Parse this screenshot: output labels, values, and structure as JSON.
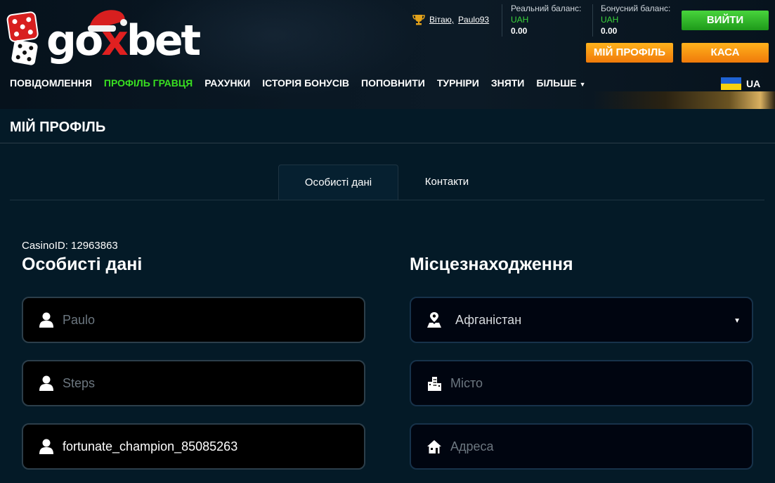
{
  "brand": {
    "logo_text_pre": "go",
    "logo_text_x": "x",
    "logo_text_post": "bet",
    "accent": "#39e020"
  },
  "user": {
    "greeting": "Вітаю,",
    "username": "Paulo93"
  },
  "balances": {
    "real": {
      "label": "Реальний баланс:",
      "currency": "UAH",
      "value": "0.00"
    },
    "bonus": {
      "label": "Бонусний баланс:",
      "currency": "UAH",
      "value": "0.00"
    }
  },
  "buttons": {
    "login": "ВИЙТИ",
    "profile": "МІЙ ПРОФІЛЬ",
    "cashier": "КАСА"
  },
  "nav": {
    "items": [
      "ПОВІДОМЛЕННЯ",
      "ПРОФІЛЬ ГРАВЦЯ",
      "РАХУНКИ",
      "ІСТОРІЯ БОНУСІВ",
      "ПОПОВНИТИ",
      "ТУРНІРИ",
      "ЗНЯТИ",
      "БІЛЬШЕ"
    ],
    "active_index": 1,
    "language": "UA"
  },
  "page": {
    "title": "МІЙ ПРОФІЛЬ",
    "tabs": [
      "Особисті дані",
      "Контакти"
    ],
    "casino_id": "CasinoID: 12963863"
  },
  "personal": {
    "title": "Особисті дані",
    "first_name_placeholder": "Paulo",
    "last_name_placeholder": "Steps",
    "nickname_value": "fortunate_champion_85085263"
  },
  "location": {
    "title": "Місцезнаходження",
    "country_value": "Афганістан",
    "city_placeholder": "Місто",
    "address_placeholder": "Адреса"
  }
}
